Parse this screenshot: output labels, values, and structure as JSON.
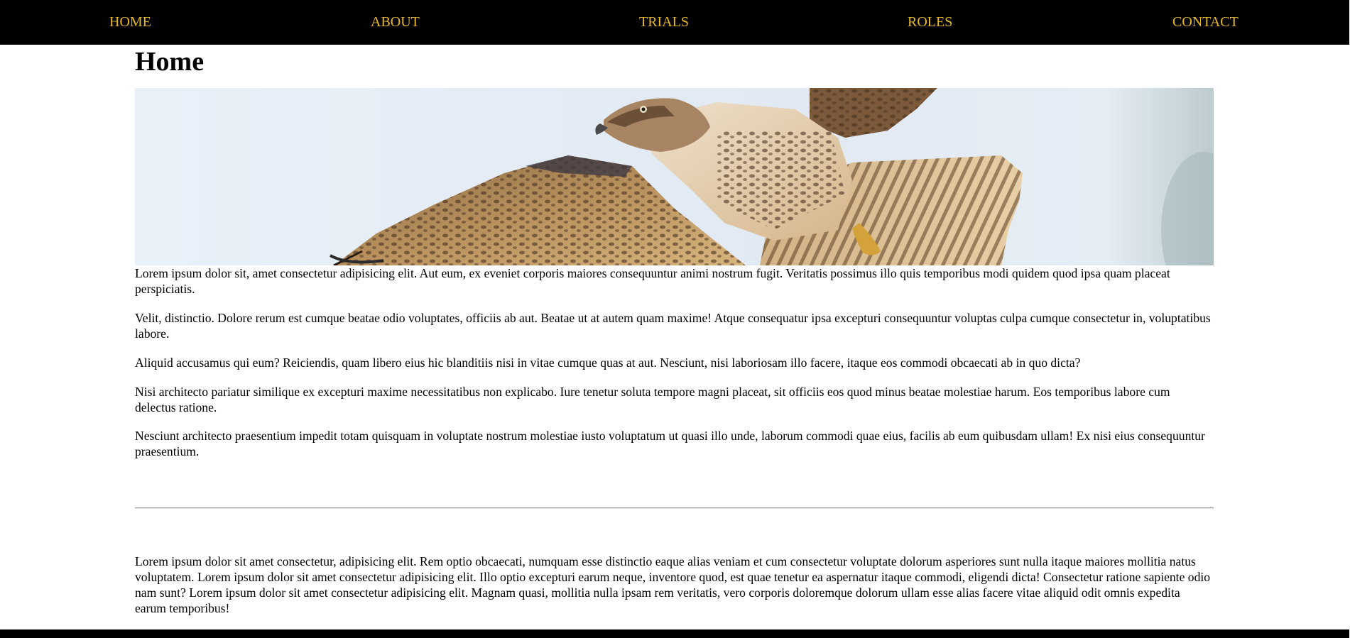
{
  "nav": {
    "items": [
      {
        "label": "HOME"
      },
      {
        "label": "ABOUT"
      },
      {
        "label": "TRIALS"
      },
      {
        "label": "ROLES"
      },
      {
        "label": "CONTACT"
      }
    ],
    "text_color": "#e8b923",
    "background": "#000000"
  },
  "main": {
    "title": "Home",
    "hero_image": "hawk-in-flight",
    "paragraphs": [
      "Lorem ipsum dolor sit, amet consectetur adipisicing elit. Aut eum, ex eveniet corporis maiores consequuntur animi nostrum fugit. Veritatis possimus illo quis temporibus modi quidem quod ipsa quam placeat perspiciatis.",
      "Velit, distinctio. Dolore rerum est cumque beatae odio voluptates, officiis ab aut. Beatae ut at autem quam maxime! Atque consequatur ipsa excepturi consequuntur voluptas culpa cumque consectetur in, voluptatibus labore.",
      "Aliquid accusamus qui eum? Reiciendis, quam libero eius hic blanditiis nisi in vitae cumque quas at aut. Nesciunt, nisi laboriosam illo facere, itaque eos commodi obcaecati ab in quo dicta?",
      "Nisi architecto pariatur similique ex excepturi maxime necessitatibus non explicabo. Iure tenetur soluta tempore magni placeat, sit officiis eos quod minus beatae molestiae harum. Eos temporibus labore cum delectus ratione.",
      "Nesciunt architecto praesentium impedit totam quisquam in voluptate nostrum molestiae iusto voluptatum ut quasi illo unde, laborum commodi quae eius, facilis ab eum quibusdam ullam! Ex nisi eius consequuntur praesentium."
    ],
    "bottom_paragraph": "Lorem ipsum dolor sit amet consectetur, adipisicing elit. Rem optio obcaecati, numquam esse distinctio eaque alias veniam et cum consectetur voluptate dolorum asperiores sunt nulla itaque maiores mollitia natus voluptatem. Lorem ipsum dolor sit amet consectetur adipisicing elit. Illo optio excepturi earum neque, inventore quod, est quae tenetur ea aspernatur itaque commodi, eligendi dicta! Consectetur ratione sapiente odio nam sunt? Lorem ipsum dolor sit amet consectetur adipisicing elit. Magnam quasi, mollitia nulla ipsam rem veritatis, vero corporis doloremque dolorum ullam esse alias facere vitae aliquid odit omnis expedita earum temporibus!"
  }
}
